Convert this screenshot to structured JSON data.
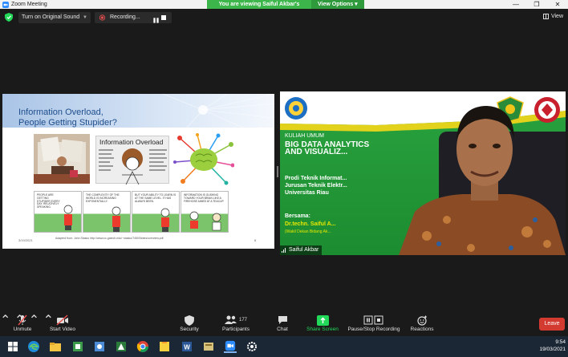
{
  "window": {
    "title": "Zoom Meeting",
    "viewing_banner": "You are viewing Saiful Akbar's screen",
    "view_options": "View Options",
    "controls": [
      "—",
      "❐",
      "✕"
    ]
  },
  "topbar": {
    "sound_label": "Turn on Original Sound",
    "recording_label": "Recording...",
    "view_label": "View"
  },
  "slide": {
    "title_line1": "Information Overload,",
    "title_line2": "People Getting Stupider?",
    "image_caption": "Information Overload",
    "footer_source": "Adapted from: John Stasko http://www.cc.gatech.edu/~stasko/7450/Notes/overview.pdf",
    "date": "3/19/2021",
    "page_number": "8",
    "comic_captions": [
      "PEOPLE ARE GETTING STUPIDER EVERY DAY. RELATIVELY SPEAKING.",
      "THE COMPLEXITY OF THE WORLD IS INCREASING EXPONENTIALLY.",
      "BUT YOUR ABILITY TO LEARN IS AT THE SAME LEVEL. IT HAS ALWAYS BEEN.",
      "INFORMATION IS GUSHING TOWARD YOUR BRAIN LIKE A FIREHOSE AIMED AT A TEACUP."
    ]
  },
  "video": {
    "kuliah": "KULIAH UMUM",
    "title_line1": "BIG DATA ANALYTICS",
    "title_line2": "AND VISUALIZ...",
    "prodi_line1": "Prodi Teknik Informat...",
    "prodi_line2": "Jurusan Teknik Elektr...",
    "prodi_line3": "Universitas Riau",
    "bersama": "Bersama:",
    "speaker": "Dr.techn. Saiful A...",
    "speaker_role": "(Wakil Dekan Bidang Ak...",
    "participant_name": "Saiful Akbar"
  },
  "toolbar": {
    "unmute": "Unmute",
    "start_video": "Start Video",
    "security": "Security",
    "participants": "Participants",
    "participants_count": "177",
    "chat": "Chat",
    "share_screen": "Share Screen",
    "pause_stop": "Pause/Stop Recording",
    "reactions": "Reactions",
    "leave": "Leave"
  },
  "taskbar": {
    "time": "9:54",
    "date": "19/03/2021"
  },
  "colors": {
    "zoom_blue": "#2d8cff",
    "banner_green": "#3cb54a",
    "share_green": "#23d959",
    "leave_red": "#d33b31",
    "slide_title": "#1f4e8c"
  }
}
